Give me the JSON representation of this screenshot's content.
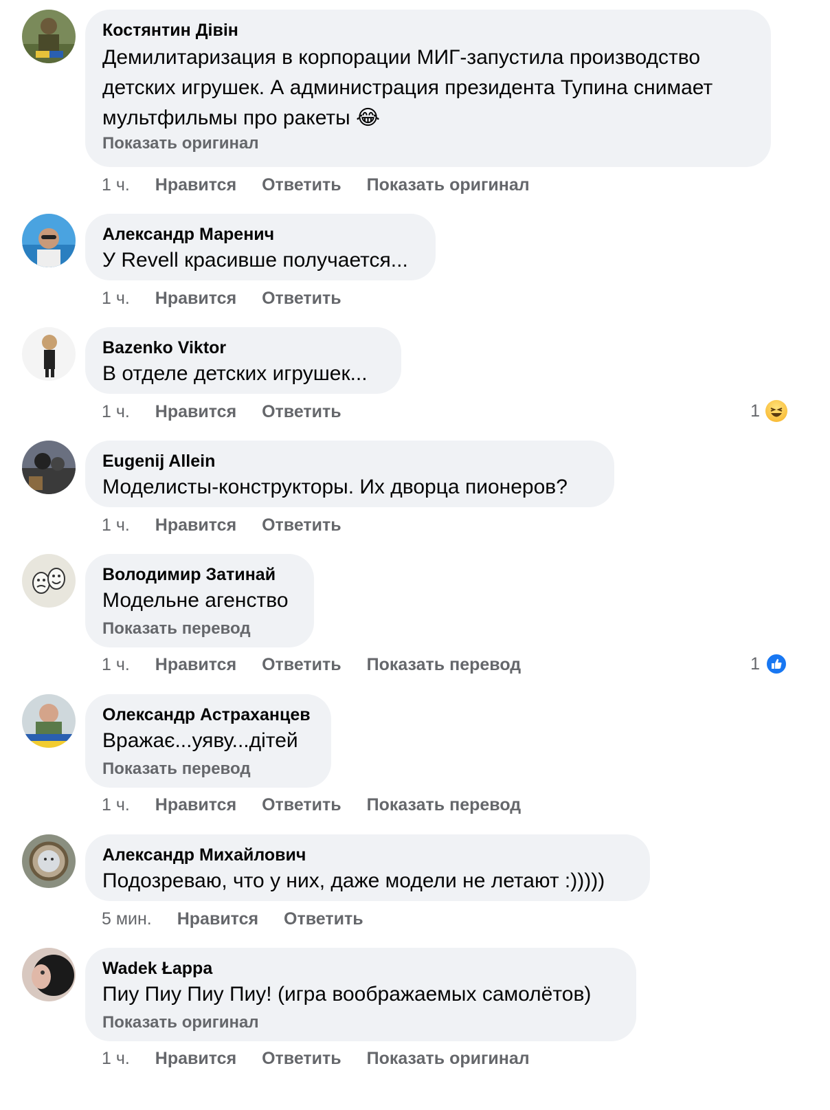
{
  "comments": [
    {
      "author": "Костянтин Дівін",
      "text": "Демилитаризация в корпорации МИГ-запустила производство детских игрушек. А администрация президента Тупина снимает мультфильмы про ракеты 😂",
      "inline_link": "Показать оригинал",
      "time": "1 ч.",
      "like": "Нравится",
      "reply": "Ответить",
      "extra": "Показать оригинал"
    },
    {
      "author": "Александр Маренич",
      "text": "У Revell красивше получается...",
      "time": "1 ч.",
      "like": "Нравится",
      "reply": "Ответить"
    },
    {
      "author": "Bazenko Viktor",
      "text": "В отделе детских игрушек...",
      "time": "1 ч.",
      "like": "Нравится",
      "reply": "Ответить",
      "reaction_count": "1",
      "reaction_icon": "haha-emoji-icon"
    },
    {
      "author": "Eugenij Allein",
      "text": "Моделисты-конструкторы. Их дворца пионеров?",
      "time": "1 ч.",
      "like": "Нравится",
      "reply": "Ответить"
    },
    {
      "author": "Володимир Затинай",
      "text": "Модельне агенство",
      "inline_link": "Показать перевод",
      "time": "1 ч.",
      "like": "Нравится",
      "reply": "Ответить",
      "extra": "Показать перевод",
      "reaction_count": "1",
      "reaction_icon": "like-thumb-icon"
    },
    {
      "author": "Олександр Астраханцев",
      "text": "Вражає...уяву...дітей",
      "inline_link": "Показать перевод",
      "time": "1 ч.",
      "like": "Нравится",
      "reply": "Ответить",
      "extra": "Показать перевод"
    },
    {
      "author": "Александр Михайлович",
      "text": "Подозреваю, что у них, даже модели не летают :)))))",
      "time": "5 мин.",
      "like": "Нравится",
      "reply": "Ответить"
    },
    {
      "author": "Wadek Łappa",
      "text": "Пиу Пиу Пиу Пиу! (игра воображаемых самолётов)",
      "inline_link": "Показать оригинал",
      "time": "1 ч.",
      "like": "Нравится",
      "reply": "Ответить",
      "extra": "Показать оригинал"
    }
  ],
  "colors": {
    "bubble": "#f0f2f5",
    "secondary_text": "#65676b",
    "primary_text": "#050505",
    "like_blue": "#1877f2"
  }
}
